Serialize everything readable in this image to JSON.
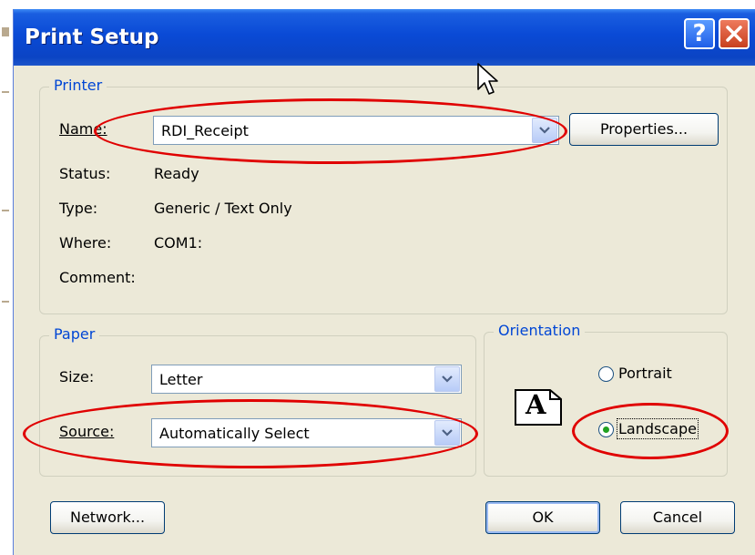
{
  "window": {
    "title": "Print Setup"
  },
  "title_buttons": {
    "help": "?",
    "close": "X"
  },
  "printer": {
    "group_label": "Printer",
    "name_label": "Name:",
    "name_value": "RDI_Receipt",
    "properties_button": "Properties...",
    "status_label": "Status:",
    "status_value": "Ready",
    "type_label": "Type:",
    "type_value": "Generic / Text Only",
    "where_label": "Where:",
    "where_value": "COM1:",
    "comment_label": "Comment:"
  },
  "paper": {
    "group_label": "Paper",
    "size_label": "Size:",
    "size_value": "Letter",
    "source_label": "Source:",
    "source_value": "Automatically Select"
  },
  "orientation": {
    "group_label": "Orientation",
    "preview_letter": "A",
    "portrait_label": "Portrait",
    "landscape_label": "Landscape",
    "selected": "Landscape"
  },
  "buttons": {
    "network": "Network...",
    "ok": "OK",
    "cancel": "Cancel"
  },
  "colors": {
    "annotation": "#e00000",
    "titlebar": "#0a4ad6",
    "group_title": "#0046d5",
    "dialog_bg": "#ece9d8"
  },
  "icons": [
    "help-icon",
    "close-icon",
    "dropdown-arrow-icon",
    "landscape-preview-icon",
    "mouse-cursor-icon"
  ]
}
